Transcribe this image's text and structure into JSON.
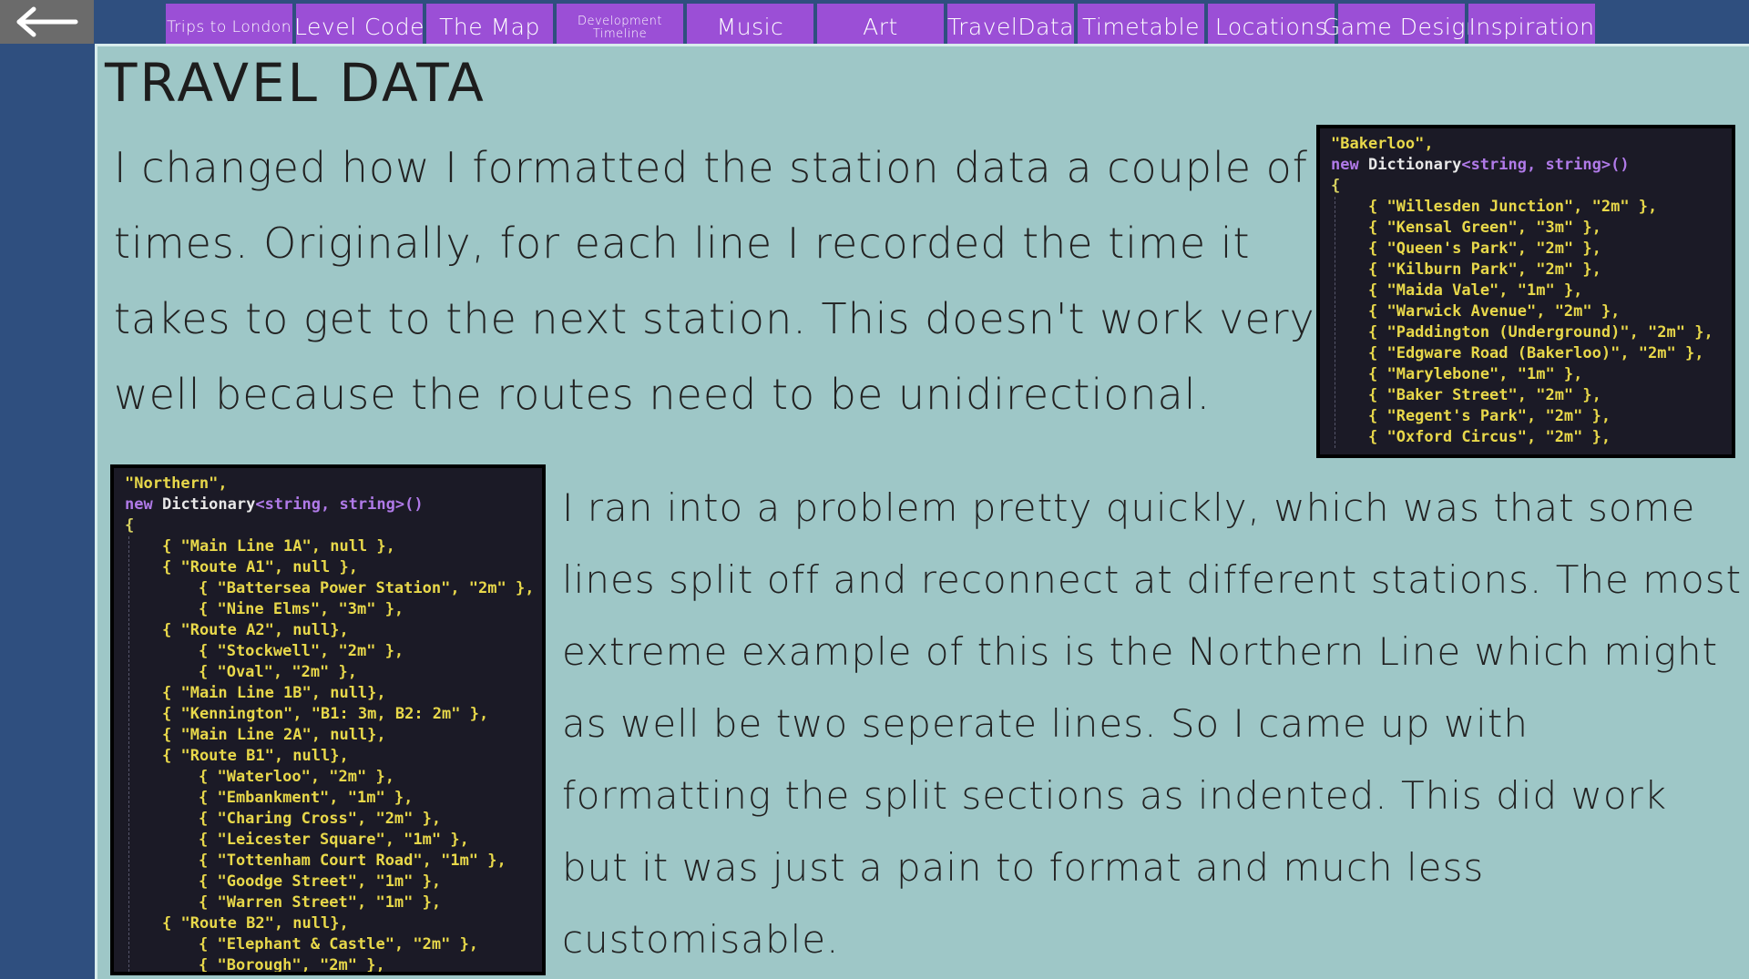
{
  "back_icon": "arrow-left-icon",
  "nav": {
    "tabs": [
      {
        "label": "Trips to London",
        "size": "small"
      },
      {
        "label": "Level Code",
        "size": "normal"
      },
      {
        "label": "The Map",
        "size": "normal"
      },
      {
        "label": "Development Timeline",
        "size": "tiny"
      },
      {
        "label": "Music",
        "size": "normal"
      },
      {
        "label": "Art",
        "size": "normal"
      },
      {
        "label": "TravelData",
        "size": "normal"
      },
      {
        "label": "Timetable",
        "size": "normal"
      },
      {
        "label": "Locations",
        "size": "normal"
      },
      {
        "label": "Game Design",
        "size": "normal"
      },
      {
        "label": "Inspiration",
        "size": "normal"
      }
    ]
  },
  "page": {
    "title": "Travel Data",
    "para1": "I changed how I formatted the station data a couple of times. Originally, for each line I recorded the time it takes to get to the next station. This doesn't work very well because the routes need to be unidirectional.",
    "para2": "I ran into a problem pretty quickly, which was that some lines split off and reconnect at different stations. The most extreme example of this is the Northern Line which might as well be two seperate lines. So I came up with formatting the split sections as indented. This did work but it was just a pain to format and much less customisable."
  },
  "code_bakerloo": {
    "header": "\"Bakerloo\",",
    "kw_new": "new",
    "type": "Dictionary",
    "generic": "<string, string>()",
    "open": "{",
    "entries": [
      "{ \"Willesden Junction\", \"2m\" },",
      "{ \"Kensal Green\", \"3m\" },",
      "{ \"Queen's Park\", \"2m\" },",
      "{ \"Kilburn Park\", \"2m\" },",
      "{ \"Maida Vale\", \"1m\" },",
      "{ \"Warwick Avenue\", \"2m\" },",
      "{ \"Paddington (Underground)\", \"2m\" },",
      "{ \"Edgware Road (Bakerloo)\", \"2m\" },",
      "{ \"Marylebone\", \"1m\" },",
      "{ \"Baker Street\", \"2m\" },",
      "{ \"Regent's Park\", \"2m\" },",
      "{ \"Oxford Circus\", \"2m\" },"
    ]
  },
  "code_northern": {
    "header": "\"Northern\",",
    "kw_new": "new",
    "type": "Dictionary",
    "generic": "<string, string>()",
    "open": "{",
    "entries": [
      {
        "text": "{ \"Main Line 1A\", null },",
        "level": 1
      },
      {
        "text": "{ \"Route A1\", null },",
        "level": 1
      },
      {
        "text": "{ \"Battersea Power Station\", \"2m\" },",
        "level": 2
      },
      {
        "text": "{ \"Nine Elms\", \"3m\" },",
        "level": 2
      },
      {
        "text": "{ \"Route A2\", null},",
        "level": 1
      },
      {
        "text": "{ \"Stockwell\", \"2m\" },",
        "level": 2
      },
      {
        "text": "{ \"Oval\", \"2m\" },",
        "level": 2
      },
      {
        "text": "{ \"Main Line 1B\", null},",
        "level": 1
      },
      {
        "text": "{ \"Kennington\", \"B1: 3m, B2: 2m\" },",
        "level": 1
      },
      {
        "text": "{ \"Main Line 2A\", null},",
        "level": 1
      },
      {
        "text": "{ \"Route B1\", null},",
        "level": 1
      },
      {
        "text": "{ \"Waterloo\", \"2m\" },",
        "level": 2
      },
      {
        "text": "{ \"Embankment\", \"1m\" },",
        "level": 2
      },
      {
        "text": "{ \"Charing Cross\", \"2m\" },",
        "level": 2
      },
      {
        "text": "{ \"Leicester Square\", \"1m\" },",
        "level": 2
      },
      {
        "text": "{ \"Tottenham Court Road\", \"1m\" },",
        "level": 2
      },
      {
        "text": "{ \"Goodge Street\", \"1m\" },",
        "level": 2
      },
      {
        "text": "{ \"Warren Street\", \"1m\" },",
        "level": 2
      },
      {
        "text": "{ \"Route B2\", null},",
        "level": 1
      },
      {
        "text": "{ \"Elephant & Castle\", \"2m\" },",
        "level": 2
      },
      {
        "text": "{ \"Borough\", \"2m\" },",
        "level": 2
      }
    ]
  }
}
